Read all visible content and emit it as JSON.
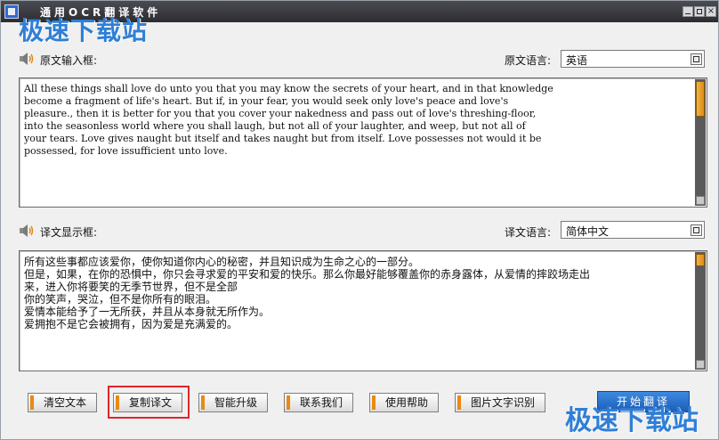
{
  "window": {
    "title": "通用OCR翻译软件",
    "watermark": "极速下载站"
  },
  "source": {
    "label": "原文输入框:",
    "lang_label": "原文语言:",
    "lang_value": "英语",
    "text": "All these things shall love do unto you that you may know the secrets of your heart, and in that knowledge\nbecome a fragment of life's heart. But if, in your fear, you would seek only love's peace and love's\npleasure., then it is better for you that you cover your nakedness and pass out of love's threshing-floor,\ninto the seasonless world where you shall laugh, but not all of your laughter, and weep, but not all of\nyour tears. Love gives naught but itself and takes naught but from itself. Love possesses not would it be\npossessed, for love issufficient unto love."
  },
  "target": {
    "label": "译文显示框:",
    "lang_label": "译文语言:",
    "lang_value": "简体中文",
    "text": "所有这些事都应该爱你，使你知道你内心的秘密，并且知识成为生命之心的一部分。\n但是，如果，在你的恐惧中，你只会寻求爱的平安和爱的快乐。那么你最好能够覆盖你的赤身露体，从爱情的摔跤场走出\n来，进入你将要笑的无季节世界，但不是全部\n你的笑声，哭泣，但不是你所有的眼泪。\n爱情本能给予了一无所获，并且从本身就无所作为。\n爱拥抱不是它会被拥有，因为爱是充满爱的。"
  },
  "buttons": {
    "clear": "清空文本",
    "copy": "复制译文",
    "upgrade": "智能升级",
    "contact": "联系我们",
    "help": "使用帮助",
    "image_ocr": "图片文字识别",
    "start": "开始翻译"
  },
  "colors": {
    "accent": "#e88a14",
    "start_button": "#2a74cc",
    "highlight": "#e0262c",
    "watermark": "#2f7fd6"
  }
}
